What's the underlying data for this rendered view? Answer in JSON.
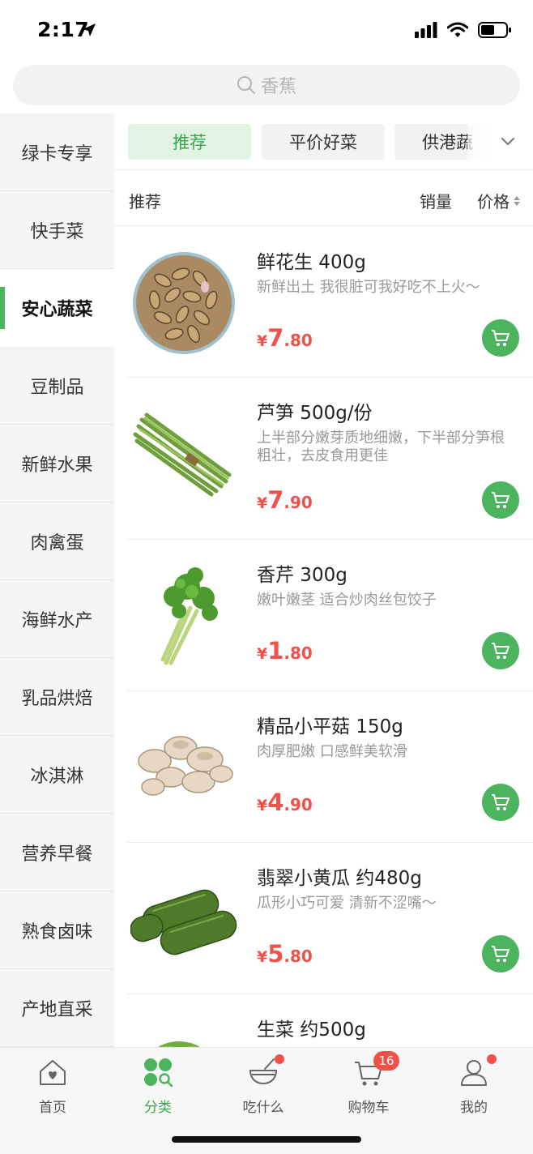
{
  "status_bar": {
    "time": "2:17"
  },
  "search": {
    "placeholder": "香蕉"
  },
  "sidebar": {
    "items": [
      {
        "label": "绿卡专享"
      },
      {
        "label": "快手菜"
      },
      {
        "label": "安心蔬菜",
        "active": true
      },
      {
        "label": "豆制品"
      },
      {
        "label": "新鲜水果"
      },
      {
        "label": "肉禽蛋"
      },
      {
        "label": "海鲜水产"
      },
      {
        "label": "乳品烘焙"
      },
      {
        "label": "冰淇淋"
      },
      {
        "label": "营养早餐"
      },
      {
        "label": "熟食卤味"
      },
      {
        "label": "产地直采"
      }
    ]
  },
  "chips": [
    {
      "label": "推荐",
      "active": true
    },
    {
      "label": "平价好菜"
    },
    {
      "label": "供港蔬"
    }
  ],
  "sort": {
    "recommend": "推荐",
    "sales": "销量",
    "price": "价格"
  },
  "products": [
    {
      "name": "鲜花生 400g",
      "desc": "新鲜出土 我很脏可我好吃不上火～",
      "price_yen": "¥",
      "price_int": "7",
      "price_dec": ".80"
    },
    {
      "name": "芦笋 500g/份",
      "desc": "上半部分嫩芽质地细嫩，下半部分笋根粗壮，去皮食用更佳",
      "price_yen": "¥",
      "price_int": "7",
      "price_dec": ".90"
    },
    {
      "name": "香芹 300g",
      "desc": "嫩叶嫩茎 适合炒肉丝包饺子",
      "price_yen": "¥",
      "price_int": "1",
      "price_dec": ".80"
    },
    {
      "name": "精品小平菇 150g",
      "desc": "肉厚肥嫩 口感鲜美软滑",
      "price_yen": "¥",
      "price_int": "4",
      "price_dec": ".90"
    },
    {
      "name": "翡翠小黄瓜 约480g",
      "desc": "瓜形小巧可爱 清新不涩嘴～",
      "price_yen": "¥",
      "price_int": "5",
      "price_dec": ".80"
    },
    {
      "name": "生菜 约500g",
      "desc": "",
      "price_yen": "",
      "price_int": "",
      "price_dec": ""
    }
  ],
  "tabbar": {
    "items": [
      {
        "label": "首页",
        "icon": "home-icon"
      },
      {
        "label": "分类",
        "icon": "category-icon",
        "active": true
      },
      {
        "label": "吃什么",
        "icon": "bowl-icon",
        "dot": true
      },
      {
        "label": "购物车",
        "icon": "cart-icon",
        "badge": "16"
      },
      {
        "label": "我的",
        "icon": "profile-icon",
        "dot": true
      }
    ]
  },
  "colors": {
    "accent_green": "#4cb45e",
    "price_red": "#f0524a",
    "chip_active_bg": "#e1f4e4"
  }
}
